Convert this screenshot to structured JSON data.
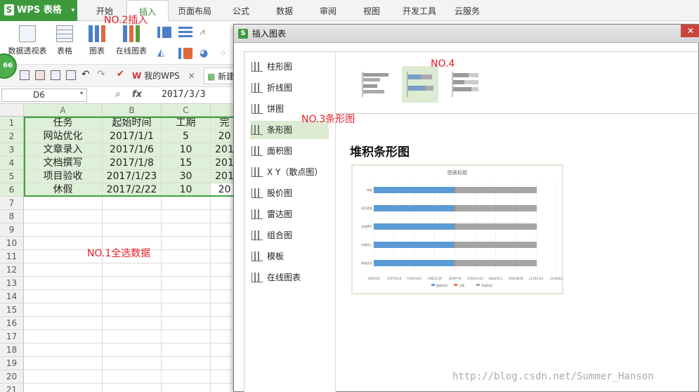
{
  "app": {
    "logo_label": "WPS 表格"
  },
  "menu": [
    "开始",
    "插入",
    "页面布局",
    "公式",
    "数据",
    "审阅",
    "视图",
    "开发工具",
    "云服务"
  ],
  "ribbon": {
    "pivot_label": "数据透视表",
    "table_label": "表格",
    "chart_label": "图表",
    "online_chart_label": "在线图表"
  },
  "quickbar": {
    "badge": "66",
    "tab_wps": "我的WPS",
    "tab_new": "新建"
  },
  "formula": {
    "cell_ref": "D6",
    "fx": "fx",
    "value": "2017/3/3"
  },
  "grid": {
    "columns": [
      "A",
      "B",
      "C"
    ],
    "rows": [
      "1",
      "2",
      "3",
      "4",
      "5",
      "6",
      "7",
      "8",
      "9",
      "10",
      "11",
      "12",
      "13",
      "14",
      "15",
      "16",
      "17",
      "18",
      "19",
      "20",
      "21"
    ],
    "data": [
      [
        "任务",
        "起始时间",
        "工期",
        "完"
      ],
      [
        "网站优化",
        "2017/1/1",
        "5",
        "20"
      ],
      [
        "文章录入",
        "2017/1/6",
        "10",
        "201"
      ],
      [
        "文档撰写",
        "2017/1/8",
        "15",
        "201"
      ],
      [
        "项目验收",
        "2017/1/23",
        "30",
        "201"
      ],
      [
        "休假",
        "2017/2/22",
        "10",
        "20"
      ]
    ]
  },
  "annotations": {
    "no1": "NO.1全选数据",
    "no2": "NO.2插入",
    "no3": "NO.3条形图",
    "no4": "NO.4"
  },
  "dialog": {
    "title": "插入图表",
    "close": "✕",
    "categories": [
      "柱形图",
      "折线图",
      "饼图",
      "条形图",
      "面积图",
      "X Y（散点图）",
      "股价图",
      "雷达图",
      "组合图",
      "模板",
      "在线图表"
    ],
    "selected_category": "条形图",
    "subtype_name": "堆积条形图",
    "preview_title": "图表标题"
  },
  "chart_data": {
    "type": "bar",
    "orientation": "horizontal",
    "stacked": true,
    "title": "图表标题",
    "categories": [
      "网站优化",
      "文章录入",
      "文档撰写",
      "项目验收",
      "休假"
    ],
    "series": [
      {
        "name": "起始时间",
        "values": [
          "2017/1/1",
          "2017/1/6",
          "2017/1/8",
          "2017/1/23",
          "2017/2/22"
        ],
        "color": "#5b9bd5"
      },
      {
        "name": "工期",
        "values": [
          5,
          10,
          15,
          30,
          10
        ],
        "color": "#ed7d31"
      },
      {
        "name": "完成时间",
        "values": [
          null,
          null,
          null,
          null,
          "2017/3/3"
        ],
        "color": "#a5a5a5"
      }
    ],
    "x_ticks": [
      "1900/1/0",
      "1927/5/18",
      "1954/10/3",
      "1982/2/19",
      "2009/7/8",
      "2036/11/23",
      "2064/4/11",
      "2091/8/28",
      "2119/1/14",
      "2146/6/2"
    ]
  },
  "watermark": "http://blog.csdn.net/Summer_Hanson"
}
